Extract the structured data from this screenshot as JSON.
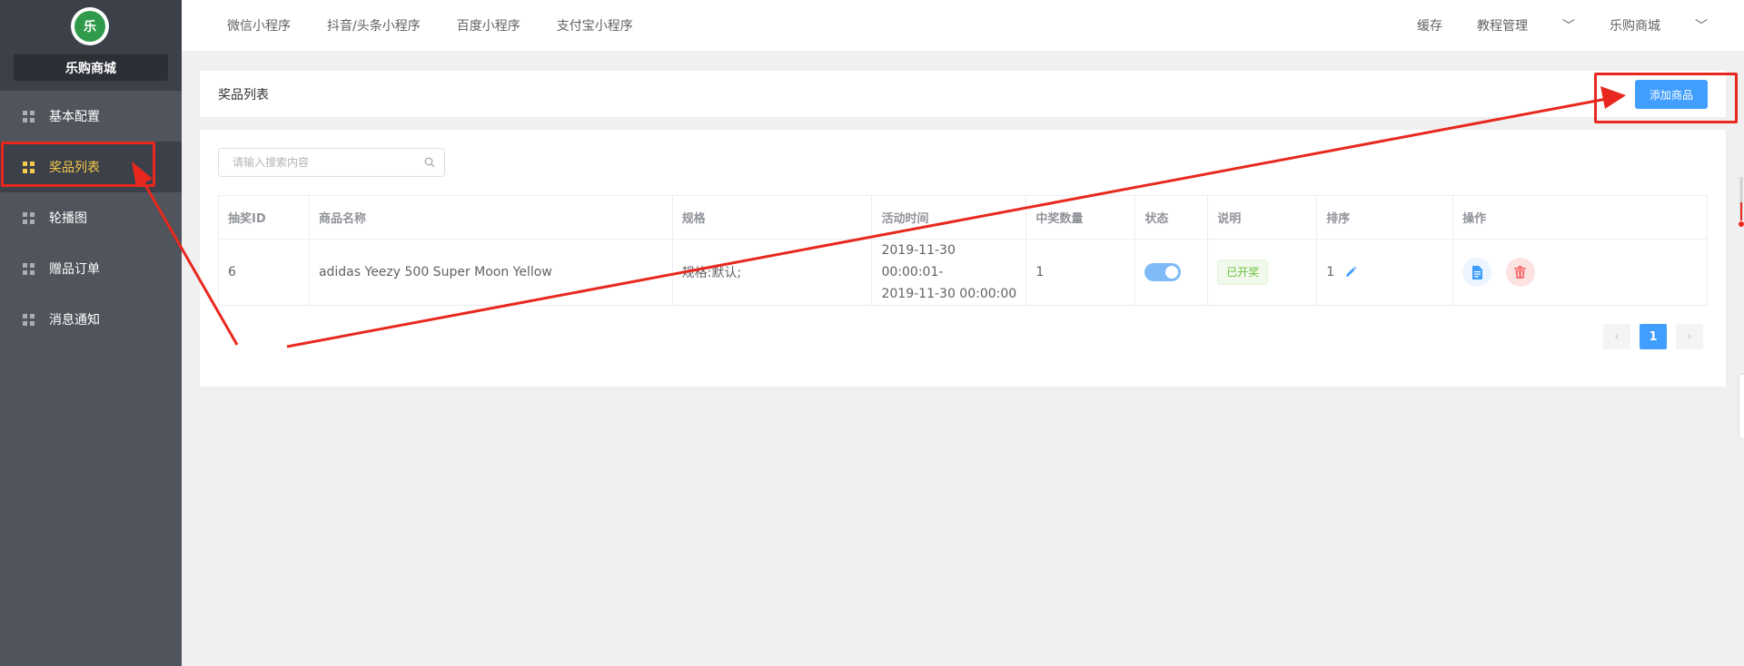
{
  "sidebar": {
    "logo_text": "乐",
    "shop_name": "乐购商城",
    "items": [
      {
        "label": "基本配置"
      },
      {
        "label": "奖品列表"
      },
      {
        "label": "轮播图"
      },
      {
        "label": "赠品订单"
      },
      {
        "label": "消息通知"
      }
    ]
  },
  "topbar": {
    "links": [
      "微信小程序",
      "抖音/头条小程序",
      "百度小程序",
      "支付宝小程序"
    ],
    "right": {
      "cache": "缓存",
      "tutorial": "教程管理",
      "shop": "乐购商城"
    }
  },
  "header": {
    "title": "奖品列表",
    "add_button": "添加商品"
  },
  "search": {
    "placeholder": "请输入搜索内容"
  },
  "table": {
    "headers": [
      "抽奖ID",
      "商品名称",
      "规格",
      "活动时间",
      "中奖数量",
      "状态",
      "说明",
      "排序",
      "操作"
    ],
    "rows": [
      {
        "id": "6",
        "name": "adidas Yeezy 500 Super Moon Yellow",
        "spec": "规格:默认;",
        "time_start": "2019-11-30 00:00:01-",
        "time_end": "2019-11-30 00:00:00",
        "win_count": "1",
        "status_on": true,
        "note": "已开奖",
        "sort": "1"
      }
    ]
  },
  "pagination": {
    "prev": "‹",
    "current": "1",
    "next": "›"
  },
  "colors": {
    "primary": "#409eff",
    "sidebar_bg": "#50545c",
    "active_menu": "#f6c94a",
    "annotation": "#e8281e",
    "success": "#67c23a",
    "danger": "#f56c6c"
  }
}
